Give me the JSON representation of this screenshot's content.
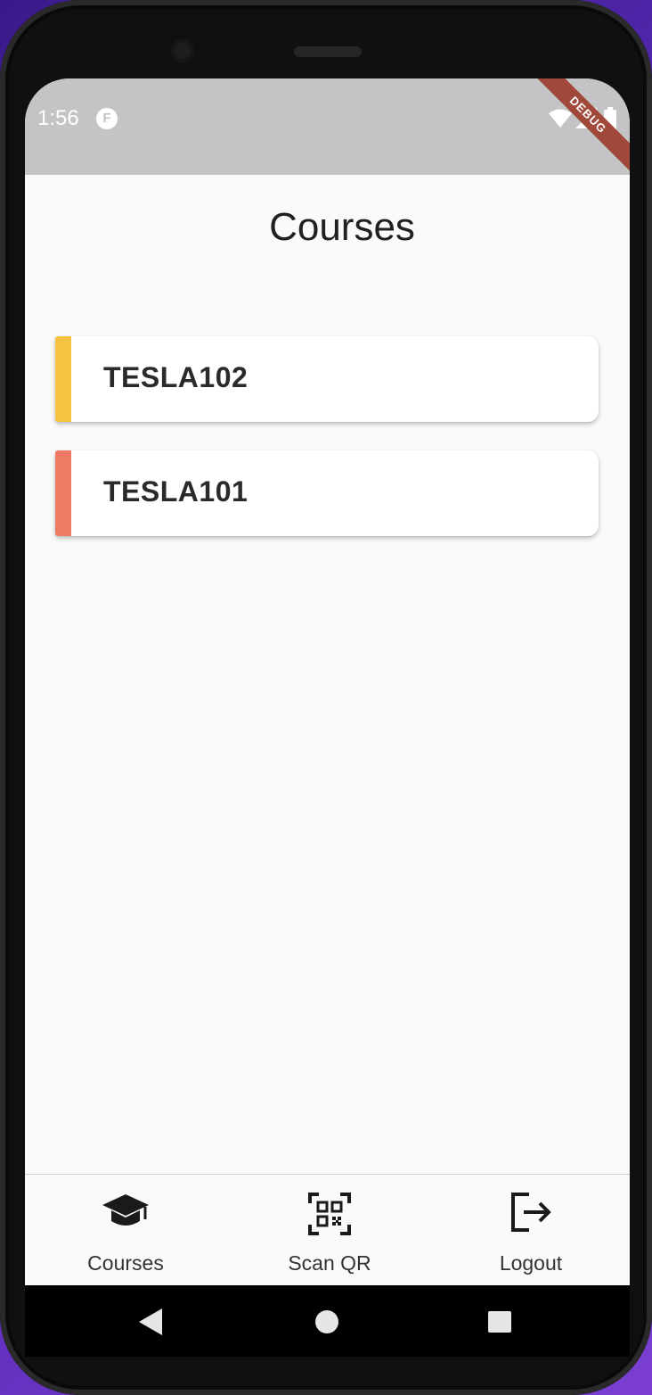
{
  "status_bar": {
    "time": "1:56",
    "app_icon_glyph": "F",
    "debug_label": "DEBUG"
  },
  "page": {
    "title": "Courses"
  },
  "courses": [
    {
      "label": "TESLA102",
      "accent_color": "#f5c242"
    },
    {
      "label": "TESLA101",
      "accent_color": "#ee7965"
    }
  ],
  "bottom_nav": {
    "items": [
      {
        "label": "Courses",
        "icon": "graduation-cap-icon"
      },
      {
        "label": "Scan QR",
        "icon": "qr-code-scan-icon"
      },
      {
        "label": "Logout",
        "icon": "logout-icon"
      }
    ]
  },
  "colors": {
    "status_bar_bg": "#c4c4c4",
    "screen_bg": "#fafafa",
    "debug_banner": "#a0483a"
  }
}
